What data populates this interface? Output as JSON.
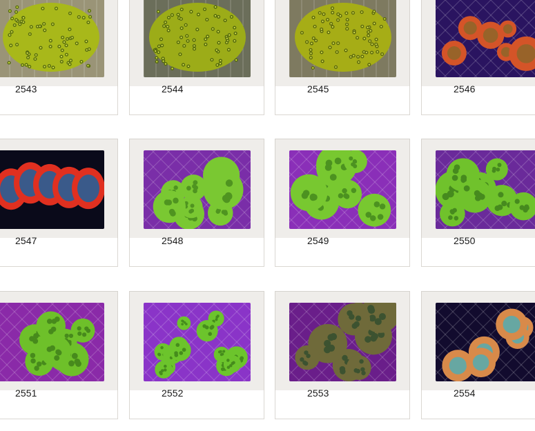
{
  "items": [
    {
      "lot": "2543",
      "image": "green-zoanthid-coral-photo",
      "bg": "#9a9477",
      "coral": "#a8b81a",
      "accent": "#5a6f10",
      "pattern": "polyps"
    },
    {
      "lot": "2544",
      "image": "green-zoanthid-coral-photo",
      "bg": "#6b6e5a",
      "coral": "#9cac18",
      "accent": "#556a0e",
      "pattern": "polyps"
    },
    {
      "lot": "2545",
      "image": "green-zoanthid-coral-photo",
      "bg": "#7e7a60",
      "coral": "#a6ad16",
      "accent": "#5e6a0f",
      "pattern": "polyps"
    },
    {
      "lot": "2546",
      "image": "orange-mushroom-coral-photo",
      "bg": "#2a1460",
      "coral": "#d45428",
      "accent": "#7f6a2a",
      "pattern": "mushrooms"
    },
    {
      "lot": "2547",
      "image": "red-blue-mushroom-coral-photo",
      "bg": "#0a0a1a",
      "coral": "#e03020",
      "accent": "#3a5a8a",
      "pattern": "redblue"
    },
    {
      "lot": "2548",
      "image": "green-rhodactis-coral-photo",
      "bg": "#7a2ea8",
      "coral": "#7ac832",
      "accent": "#4f9420",
      "pattern": "rhodactis"
    },
    {
      "lot": "2549",
      "image": "green-rhodactis-coral-photo",
      "bg": "#8a2fb8",
      "coral": "#78c830",
      "accent": "#4c9220",
      "pattern": "rhodactis"
    },
    {
      "lot": "2550",
      "image": "green-rhodactis-coral-photo",
      "bg": "#6a2a9a",
      "coral": "#70c22c",
      "accent": "#468a1e",
      "pattern": "rhodactis"
    },
    {
      "lot": "2551",
      "image": "green-rhodactis-coral-photo",
      "bg": "#8a2aa8",
      "coral": "#6ec02a",
      "accent": "#478a1c",
      "pattern": "rhodactis"
    },
    {
      "lot": "2552",
      "image": "green-rhodactis-coral-photo",
      "bg": "#8a34c8",
      "coral": "#6cc42c",
      "accent": "#458c1c",
      "pattern": "clusters"
    },
    {
      "lot": "2553",
      "image": "brown-rhodactis-coral-photo",
      "bg": "#6a1e8a",
      "coral": "#6f6a3a",
      "accent": "#3c5230",
      "pattern": "rhodactis"
    },
    {
      "lot": "2554",
      "image": "multicolor-mushroom-coral-photo",
      "bg": "#120b2e",
      "coral": "#d88a4a",
      "accent": "#38b4c8",
      "pattern": "mushrooms"
    }
  ]
}
